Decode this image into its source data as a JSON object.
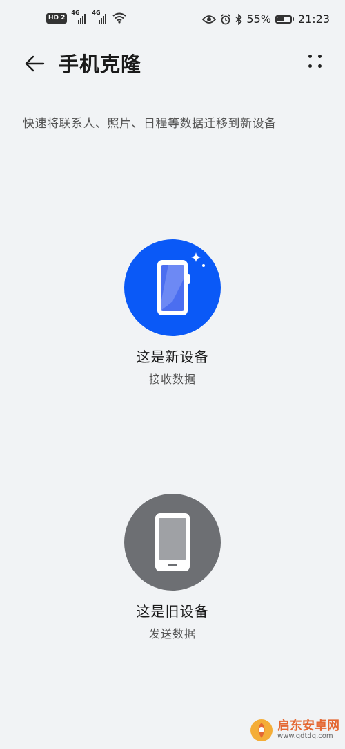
{
  "status_bar": {
    "hd_label": "HD",
    "hd_sim": "2",
    "net1": "4G",
    "net2": "4G",
    "battery_percent_text": "55%",
    "battery_level": 0.55,
    "time": "21:23"
  },
  "header": {
    "title": "手机克隆"
  },
  "subtitle": "快速将联系人、照片、日程等数据迁移到新设备",
  "options": [
    {
      "title": "这是新设备",
      "subtitle": "接收数据",
      "color": "#0a59f7"
    },
    {
      "title": "这是旧设备",
      "subtitle": "发送数据",
      "color": "#6d6f73"
    }
  ],
  "watermark": {
    "name": "启东安卓网",
    "url": "www.qdtdq.com"
  }
}
